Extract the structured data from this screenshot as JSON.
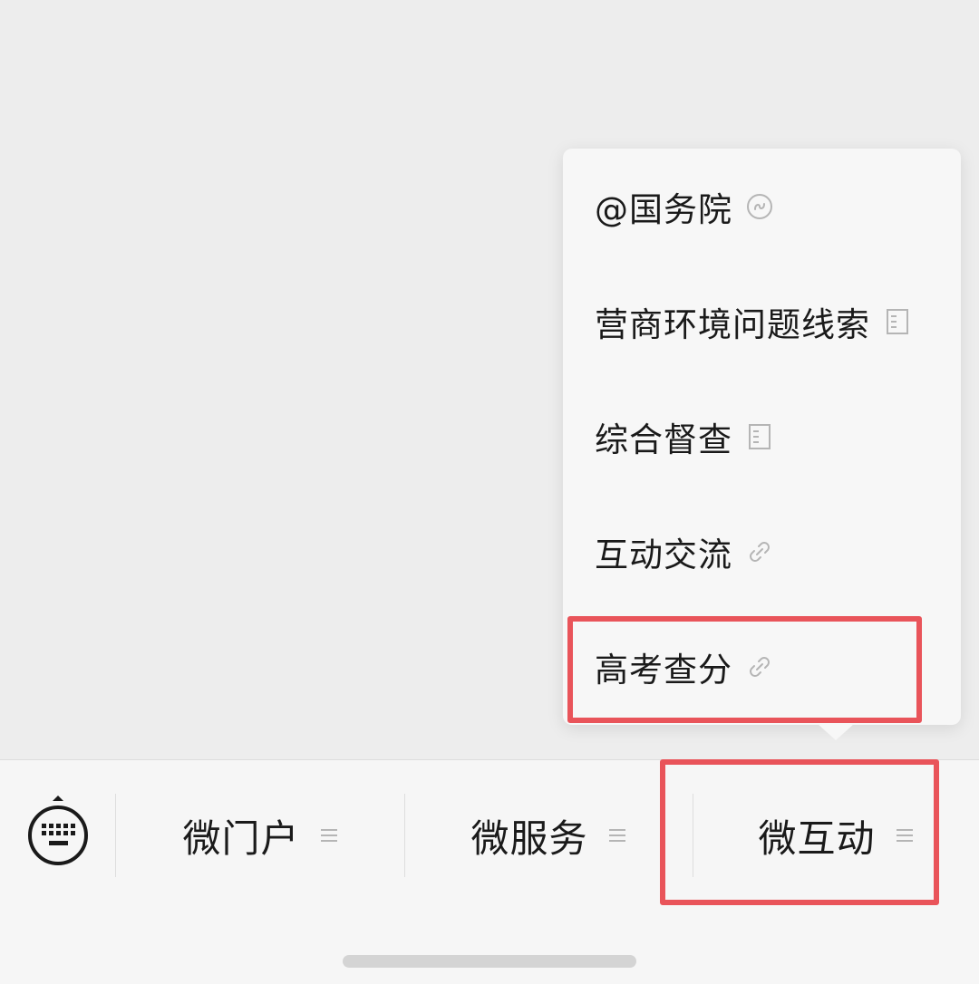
{
  "popup_menu": {
    "items": [
      {
        "label": "@国务院",
        "icon": "mini-program-icon"
      },
      {
        "label": "营商环境问题线索",
        "icon": "article-icon"
      },
      {
        "label": "综合督查",
        "icon": "article-icon"
      },
      {
        "label": "互动交流",
        "icon": "link-icon"
      },
      {
        "label": "高考查分",
        "icon": "link-icon"
      }
    ]
  },
  "bottom_bar": {
    "keyboard_icon": "keyboard-icon",
    "tabs": [
      {
        "label": "微门户",
        "icon": "menu-lines-icon"
      },
      {
        "label": "微服务",
        "icon": "menu-lines-icon"
      },
      {
        "label": "微互动",
        "icon": "menu-lines-icon"
      }
    ]
  },
  "colors": {
    "highlight": "#e9545a",
    "background": "#ededed",
    "popup_background": "#f7f7f7",
    "icon_gray": "#b5b5b5"
  }
}
